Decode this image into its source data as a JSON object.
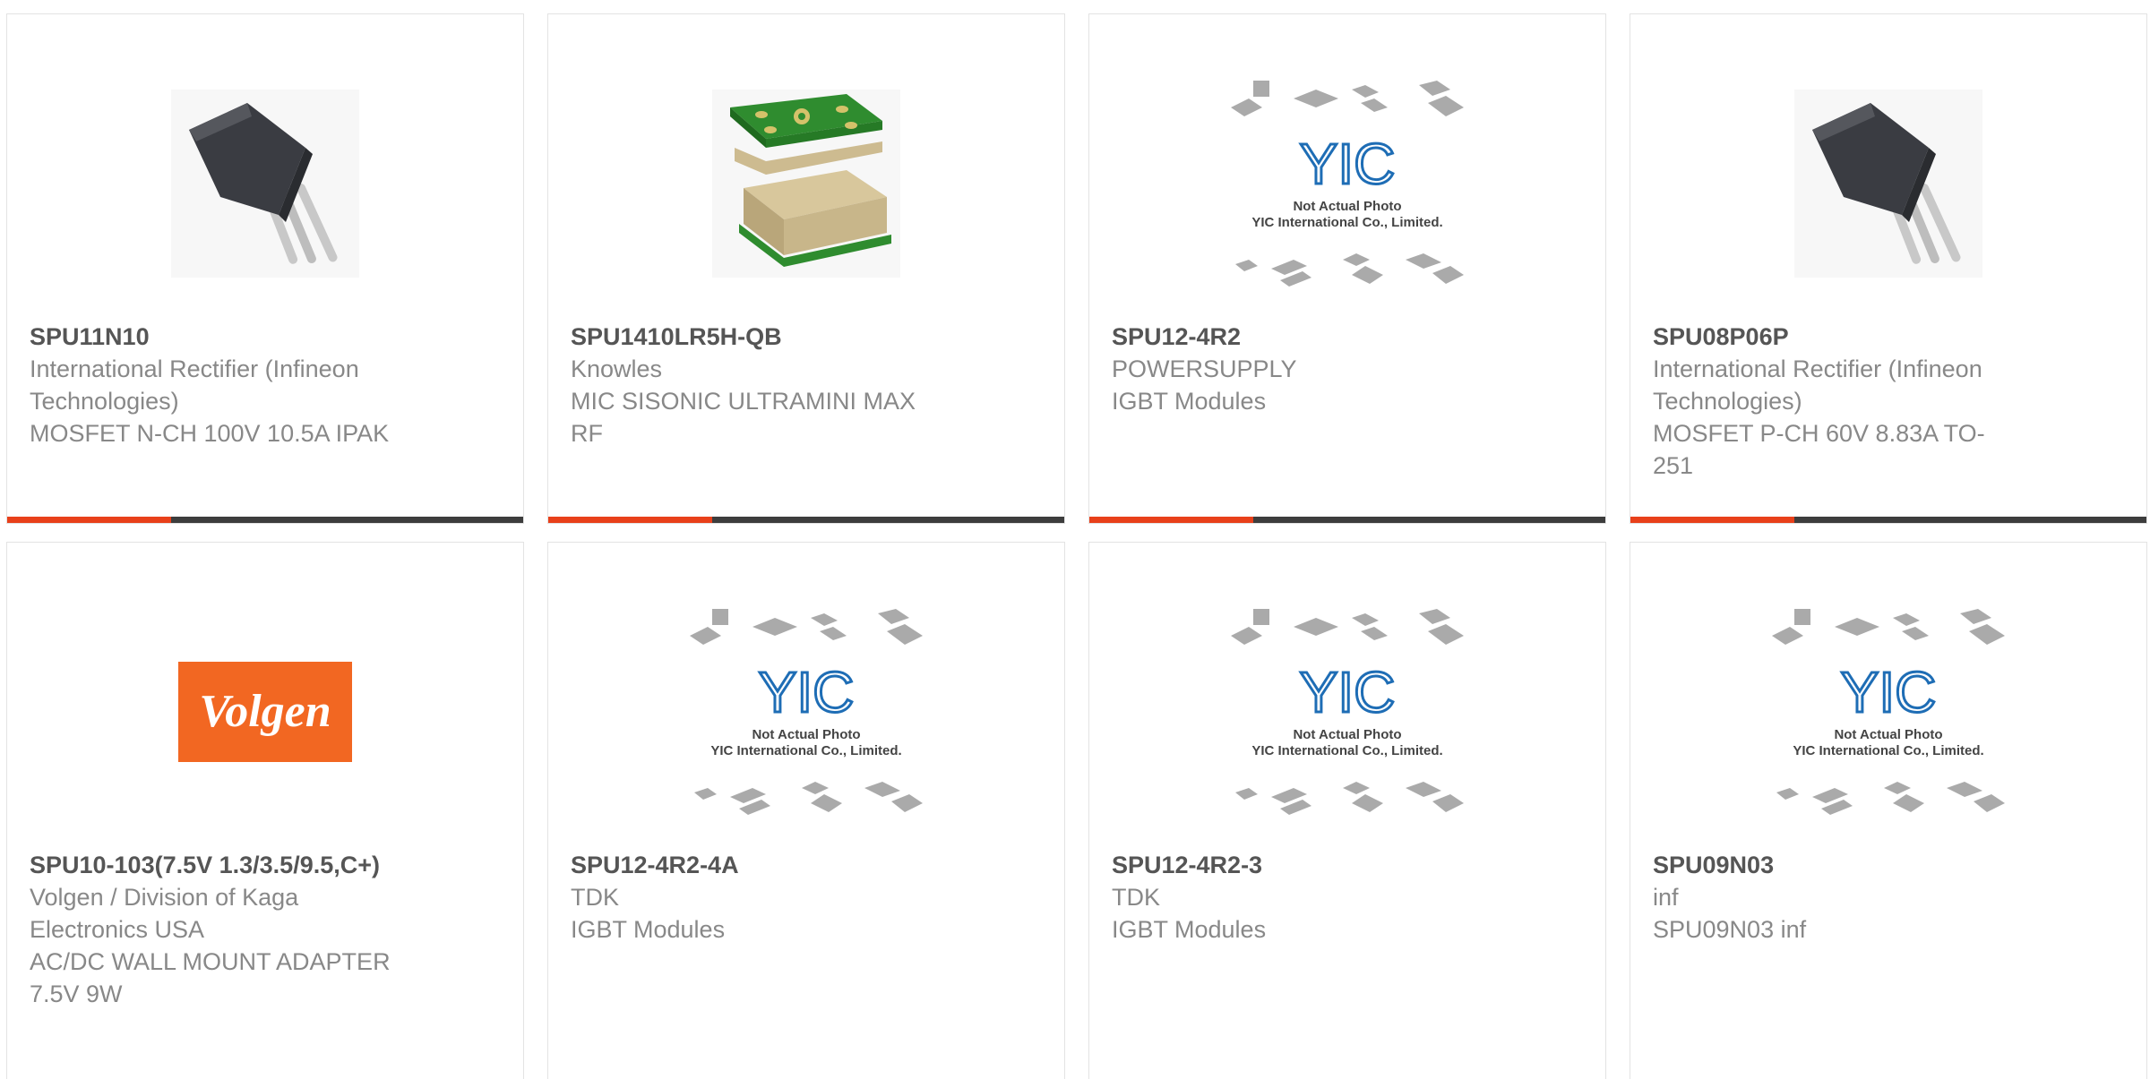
{
  "colors": {
    "accent": "#e8401a",
    "bar": "#3d3d3d",
    "title": "#555555",
    "text": "#888888",
    "volgen_bg": "#f26722",
    "yic_blue": "#1e6db5"
  },
  "placeholder": {
    "line1": "Not Actual Photo",
    "line2": "YIC International Co., Limited.",
    "logo": "YIC"
  },
  "cards": [
    {
      "part": "SPU11N10",
      "lines": [
        "International Rectifier (Infineon",
        "Technologies)",
        "MOSFET N-CH 100V 10.5A IPAK"
      ],
      "image": "to251-transistor-image"
    },
    {
      "part": "SPU1410LR5H-QB",
      "lines": [
        "Knowles",
        "MIC SISONIC ULTRAMINI MAX",
        "RF"
      ],
      "image": "mems-microphone-image"
    },
    {
      "part": "SPU12-4R2",
      "lines": [
        "POWERSUPPLY",
        "IGBT Modules",
        ""
      ],
      "image": "not-actual-photo-image"
    },
    {
      "part": "SPU08P06P",
      "lines": [
        "International Rectifier (Infineon",
        "Technologies)",
        "MOSFET P-CH 60V 8.83A TO-",
        "251"
      ],
      "image": "to251-transistor-image"
    },
    {
      "part": "SPU10-103(7.5V 1.3/3.5/9.5,C+)",
      "lines": [
        "Volgen / Division of Kaga",
        "Electronics USA",
        "AC/DC WALL MOUNT ADAPTER",
        "7.5V 9W"
      ],
      "image": "volgen-logo-image",
      "logo_text": "Volgen"
    },
    {
      "part": "SPU12-4R2-4A",
      "lines": [
        "TDK",
        "IGBT Modules",
        ""
      ],
      "image": "not-actual-photo-image"
    },
    {
      "part": "SPU12-4R2-3",
      "lines": [
        "TDK",
        "IGBT Modules",
        ""
      ],
      "image": "not-actual-photo-image"
    },
    {
      "part": "SPU09N03",
      "lines": [
        "inf",
        "SPU09N03 inf",
        ""
      ],
      "image": "not-actual-photo-image"
    }
  ]
}
